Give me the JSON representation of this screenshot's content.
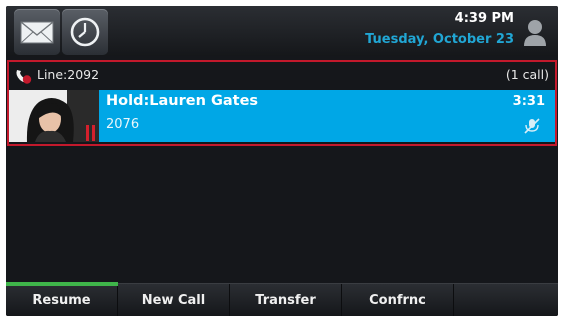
{
  "status_bar": {
    "time": "4:39 PM",
    "date": "Tuesday, October 23"
  },
  "line": {
    "label": "Line:2092",
    "call_count": "(1 call)"
  },
  "call": {
    "caller_name": "Hold:Lauren Gates",
    "caller_number": "2076",
    "duration": "3:31"
  },
  "softkeys": {
    "resume": "Resume",
    "new_call": "New Call",
    "transfer": "Transfer",
    "conference": "Confrnc"
  },
  "icons": {
    "mail": "envelope-icon",
    "clock": "clock-icon",
    "presence": "user-presence-icon",
    "line": "handset-icon",
    "mute": "muted-microphone-icon"
  },
  "colors": {
    "accent": "#00a7e6",
    "line_border": "#c3192c",
    "date_text": "#21a6d4",
    "active_softkey": "#3fb54a"
  }
}
